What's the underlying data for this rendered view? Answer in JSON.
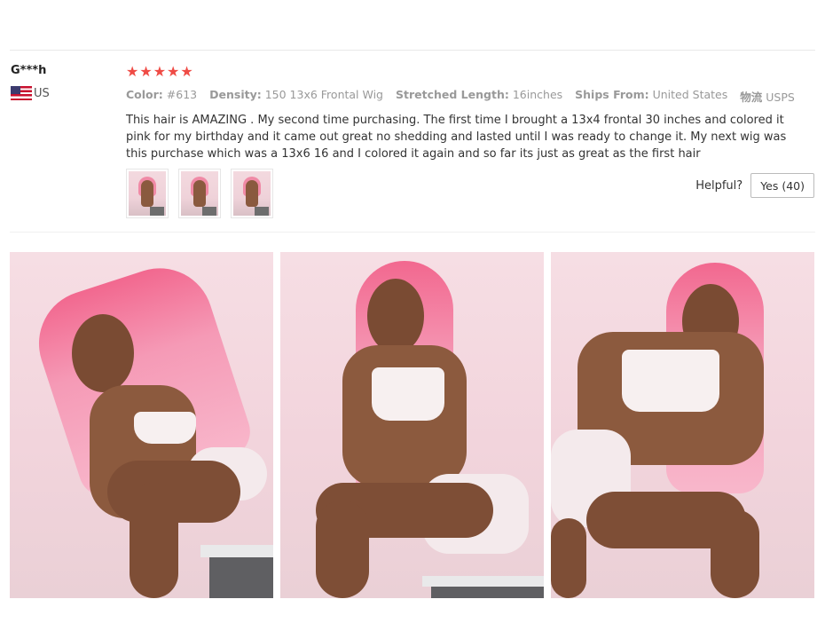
{
  "review": {
    "user_name": "G***h",
    "country": "US",
    "rating": 5,
    "stars": [
      "★",
      "★",
      "★",
      "★",
      "★"
    ],
    "attributes": [
      {
        "key": "Color:",
        "value": "#613"
      },
      {
        "key": "Density:",
        "value": "150 13x6 Frontal Wig"
      },
      {
        "key": "Stretched Length:",
        "value": "16inches"
      },
      {
        "key": "Ships From:",
        "value": "United States"
      },
      {
        "key": "物流",
        "value": "USPS"
      }
    ],
    "text": "This hair is AMAZING . My second time purchasing. The first time I brought a 13x4 frontal 30 inches and colored it pink for my birthday and it came out great no shedding and lasted until I was ready to change it. My next wig was this purchase which was a 13x6 16 and I colored it again and so far its just as great as the first hair",
    "helpful_label": "Helpful?",
    "yes_button": "Yes (40)"
  },
  "colors": {
    "star": "#ef4b45",
    "wig_pink": "#f59ab6",
    "background_pink": "#f2d4dc"
  },
  "icons": [
    "us-flag-icon",
    "star-icon"
  ]
}
